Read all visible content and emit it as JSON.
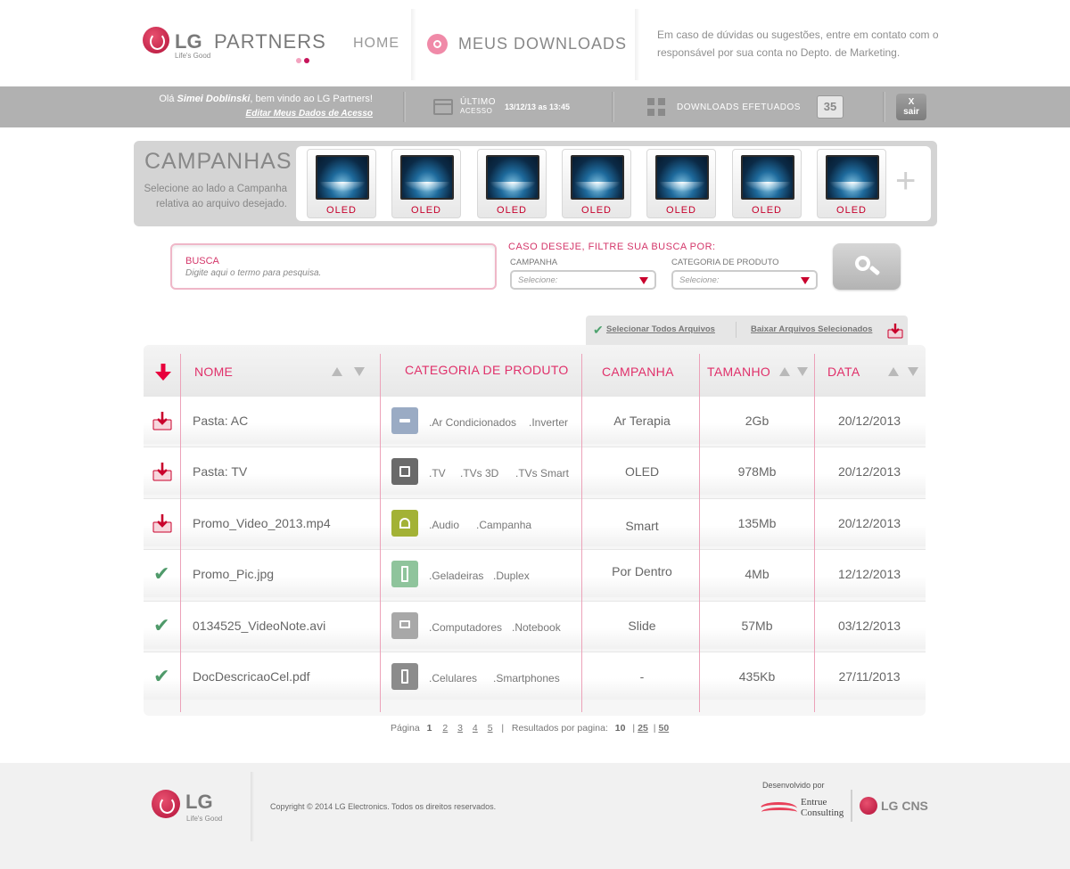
{
  "header": {
    "logo_lg": "LG",
    "logo_partners": "PARTNERS",
    "logo_tagline": "Life's Good",
    "nav_home": "HOME",
    "nav_downloads": "MEUS DOWNLOADS",
    "help_text": "Em caso de dúvidas ou sugestões, entre em contato com o responsável por sua conta no Depto. de Marketing."
  },
  "infobar": {
    "greeting_prefix": "Olá",
    "user_name": "Simei Doblinski",
    "greeting_suffix": ", bem vindo ao LG Partners!",
    "edit_link": "Editar Meus Dados de Acesso",
    "last_access_label": "ÚLTIMO",
    "last_access_sublabel": "ACESSO",
    "last_access_value": "13/12/13 as 13:45",
    "downloads_label": "DOWNLOADS EFETUADOS",
    "downloads_count": "35",
    "logout_x": "X",
    "logout_label": "sair"
  },
  "campaigns": {
    "title": "CAMPANHAS",
    "description": "Selecione ao lado a Campanha relativa ao arquivo desejado.",
    "items": [
      {
        "label": "OLED"
      },
      {
        "label": "OLED"
      },
      {
        "label": "OLED"
      },
      {
        "label": "OLED"
      },
      {
        "label": "OLED"
      },
      {
        "label": "OLED"
      },
      {
        "label": "OLED"
      }
    ],
    "more": "+"
  },
  "search": {
    "label": "BUSCA",
    "placeholder": "Digite aqui o termo para pesquisa.",
    "filter_title": "CASO DESEJE, FILTRE SUA BUSCA POR:",
    "campaign_label": "CAMPANHA",
    "category_label": "CATEGORIA DE PRODUTO",
    "select_placeholder": "Selecione:"
  },
  "actions": {
    "select_all": "Selecionar Todos Arquivos",
    "download_selected": "Baixar Arquivos Selecionados"
  },
  "table": {
    "columns": {
      "name": "NOME",
      "category": "CATEGORIA DE PRODUTO",
      "campaign": "CAMPANHA",
      "size": "TAMANHO",
      "date": "DATA"
    },
    "rows": [
      {
        "status": "download",
        "name": "Pasta: AC",
        "icon": "ac-icon",
        "icon_color": "#9aabc4",
        "cat1": ".Ar Condicionados",
        "cat2": ".Inverter",
        "campaign": "Ar Terapia",
        "size": "2Gb",
        "date": "20/12/2013"
      },
      {
        "status": "download",
        "name": "Pasta: TV",
        "icon": "tv-icon",
        "icon_color": "#6a6a6a",
        "cat1": ".TV",
        "cat2": ".TVs 3D",
        "cat3": ".TVs Smart",
        "campaign": "OLED",
        "size": "978Mb",
        "date": "20/12/2013"
      },
      {
        "status": "download",
        "name": "Promo_Video_2013.mp4",
        "icon": "headphones-icon",
        "icon_color": "#a3b236",
        "cat1": ".Audio",
        "cat2": ".Campanha",
        "campaign": "Smart",
        "size": "135Mb",
        "date": "20/12/2013"
      },
      {
        "status": "done",
        "name": "Promo_Pic.jpg",
        "icon": "fridge-icon",
        "icon_color": "#8fc49c",
        "cat1": ".Geladeiras",
        "cat2": ".Duplex",
        "campaign": "Por Dentro",
        "size": "4Mb",
        "date": "12/12/2013"
      },
      {
        "status": "done",
        "name": "0134525_VideoNote.avi",
        "icon": "laptop-icon",
        "icon_color": "#a8a8a8",
        "cat1": ".Computadores",
        "cat2": ".Notebook",
        "campaign": "Slide",
        "size": "57Mb",
        "date": "03/12/2013"
      },
      {
        "status": "done",
        "name": "DocDescricaoCel.pdf",
        "icon": "phone-icon",
        "icon_color": "#8c8c8c",
        "cat1": ".Celulares",
        "cat2": ".Smartphones",
        "campaign": "-",
        "size": "435Kb",
        "date": "27/11/2013"
      }
    ]
  },
  "pagination": {
    "label": "Página",
    "current": "1",
    "pages": [
      "2",
      "3",
      "4",
      "5"
    ],
    "sep": "|",
    "per_page_label": "Resultados por pagina:",
    "per_page_current": "10",
    "per_page_options": [
      "25",
      "50"
    ]
  },
  "footer": {
    "logo_lg": "LG",
    "logo_tagline": "Life's Good",
    "copyright": "Copyright © 2014 LG Electronics. Todos os direitos reservados.",
    "developed_by": "Desenvolvido por",
    "entrue_line1": "Entrue",
    "entrue_line2": "Consulting",
    "cns": "LG CNS"
  },
  "colors": {
    "accent": "#e0306a",
    "bar_gray": "#b1b1b1",
    "check_green": "#4f9a6a"
  }
}
